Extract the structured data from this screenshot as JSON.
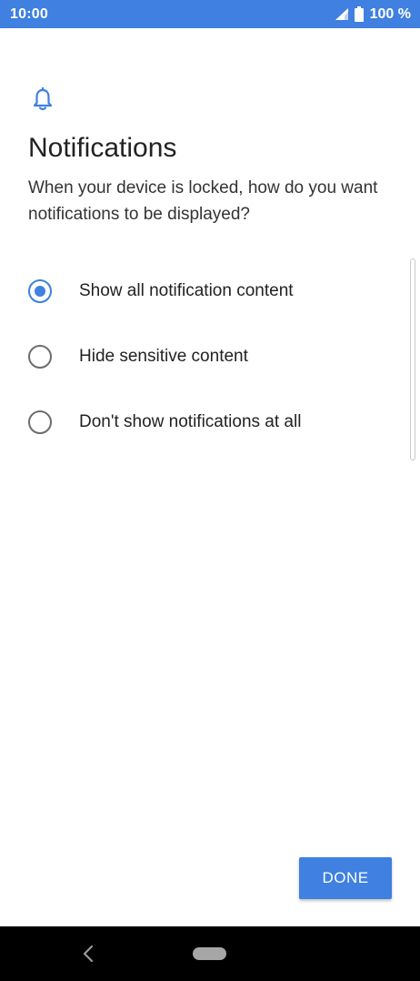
{
  "status_bar": {
    "time": "10:00",
    "battery": "100 %",
    "icons": [
      "signal-icon",
      "battery-icon"
    ]
  },
  "header": {
    "icon": "bell-icon",
    "title": "Notifications",
    "subtitle": "When your device is locked, how do you want notifications to be displayed?"
  },
  "options": [
    {
      "label": "Show all notification content",
      "selected": true
    },
    {
      "label": "Hide sensitive content",
      "selected": false
    },
    {
      "label": "Don't show notifications at all",
      "selected": false
    }
  ],
  "actions": {
    "done_label": "DONE"
  },
  "nav_bar": {
    "icons": [
      "back-icon",
      "home-icon"
    ]
  },
  "colors": {
    "accent": "#3f80e0",
    "status_bar": "#3f80e0",
    "nav_bar": "#000000"
  }
}
